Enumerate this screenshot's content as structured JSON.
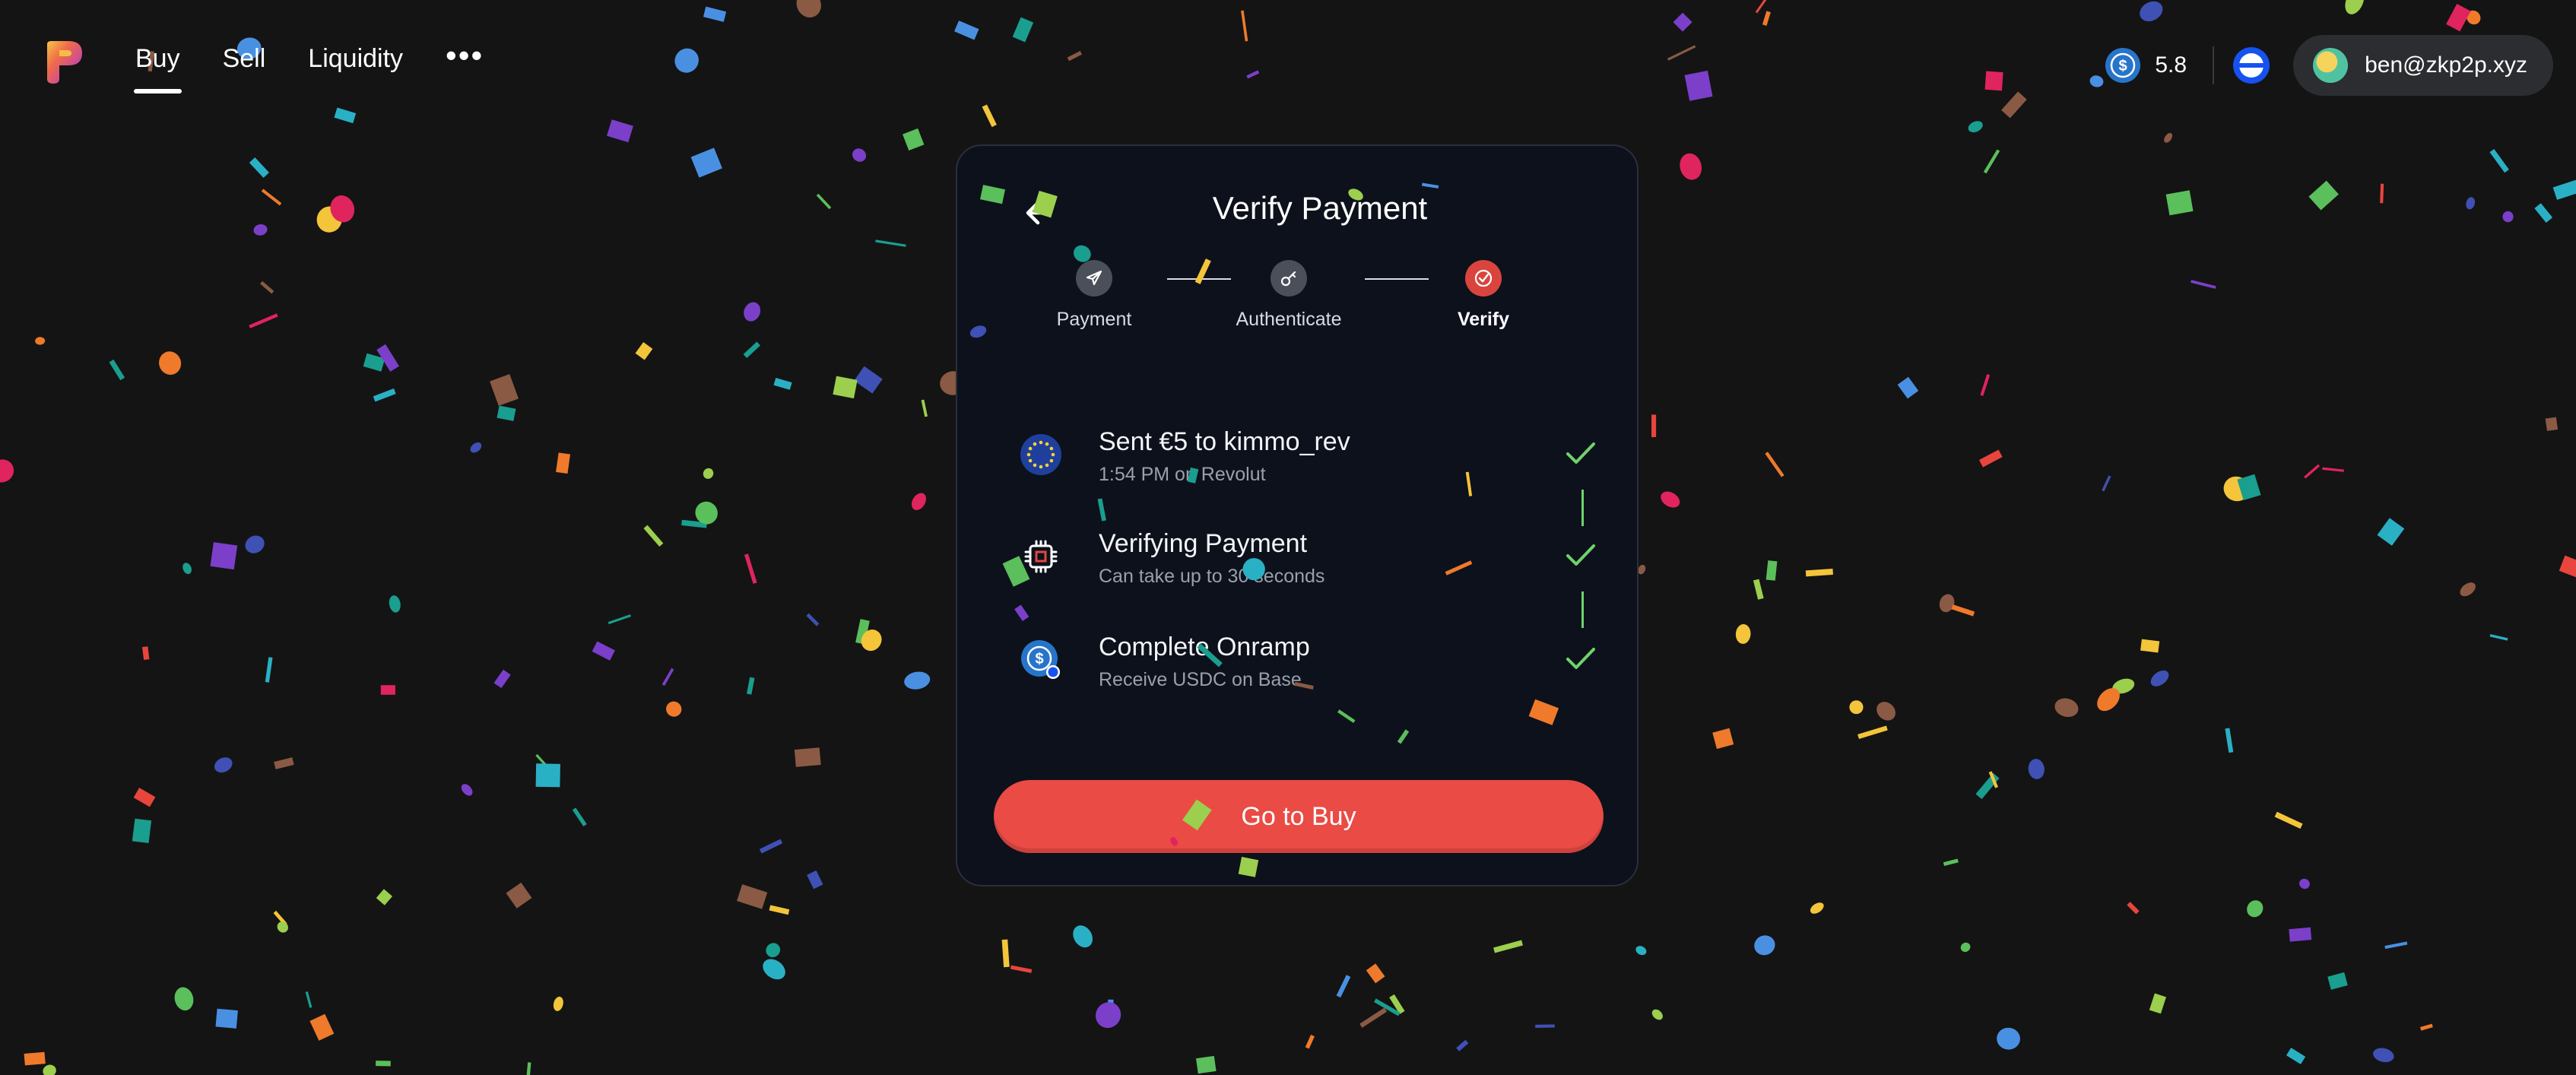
{
  "colors": {
    "background": "#141414",
    "modal_background": "#0d111c",
    "accent": "#ea4b45",
    "step_inactive": "#4a4f5a",
    "check_green": "#6fd36a",
    "usdc_blue": "#2775ca"
  },
  "header": {
    "logo_icon": "multicolor-p-logo-icon",
    "nav": [
      {
        "label": "Buy",
        "active": true
      },
      {
        "label": "Sell",
        "active": false
      },
      {
        "label": "Liquidity",
        "active": false
      }
    ],
    "more_label": "•••",
    "balance": {
      "icon": "usdc-coin-icon",
      "value": "5.8"
    },
    "network_icon": "base-network-icon",
    "account": {
      "label": "ben@zkp2p.xyz",
      "icon": "avatar-icon"
    }
  },
  "modal": {
    "title": "Verify Payment",
    "back_icon": "arrow-left-icon",
    "steps": [
      {
        "label": "Payment",
        "icon": "send-icon",
        "active": false
      },
      {
        "label": "Authenticate",
        "icon": "key-icon",
        "active": false
      },
      {
        "label": "Verify",
        "icon": "check-circle-icon",
        "active": true
      }
    ],
    "rows": [
      {
        "icon": "eu-flag-icon",
        "title": "Sent €5 to kimmo_rev",
        "subtitle": "1:54 PM on Revolut",
        "status": "done"
      },
      {
        "icon": "chip-icon",
        "title": "Verifying Payment",
        "subtitle": "Can take up to 30 seconds",
        "status": "done"
      },
      {
        "icon": "usdc-base-icon",
        "title": "Complete Onramp",
        "subtitle": "Receive USDC on Base",
        "status": "done"
      }
    ],
    "cta_label": "Go to Buy"
  }
}
